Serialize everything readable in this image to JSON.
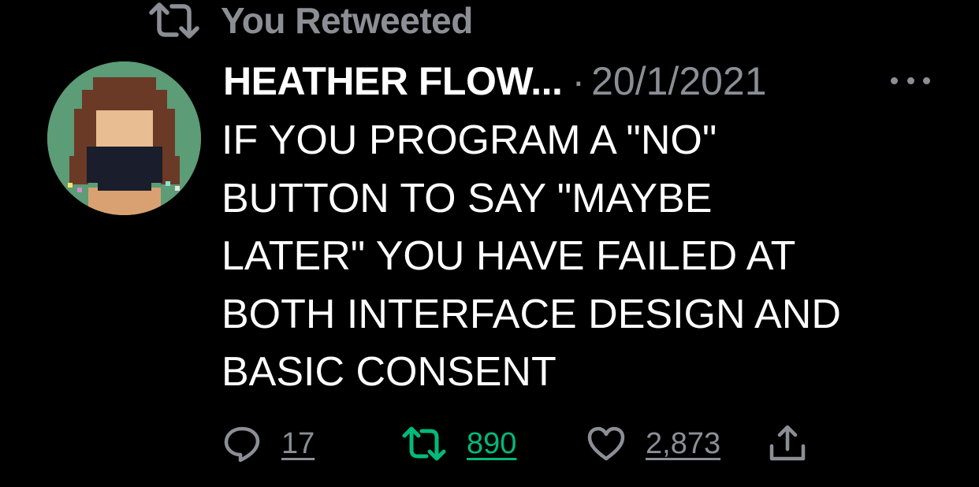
{
  "retweet_context": {
    "label": "You Retweeted",
    "icon": "retweet-icon"
  },
  "author": {
    "name": "HEATHER FLOW...",
    "avatar_icon": "pixel-art-avatar"
  },
  "tweet": {
    "separator": "·",
    "date": "20/1/2021",
    "text_lines": [
      "IF YOU PROGRAM A \"NO\"",
      "BUTTON TO SAY \"MAYBE",
      "LATER\" YOU HAVE FAILED AT",
      "BOTH INTERFACE DESIGN AND",
      "BASIC CONSENT"
    ]
  },
  "actions": {
    "reply": {
      "icon": "reply-icon",
      "count": "17"
    },
    "retweet": {
      "icon": "retweet-icon",
      "count": "890",
      "active": true
    },
    "like": {
      "icon": "heart-icon",
      "count": "2,873"
    },
    "share": {
      "icon": "share-icon"
    }
  },
  "colors": {
    "background": "#000000",
    "text": "#ffffff",
    "muted": "#8b8f95",
    "retweet_active": "#00ba7c",
    "avatar_bg": "#5c9c76"
  }
}
